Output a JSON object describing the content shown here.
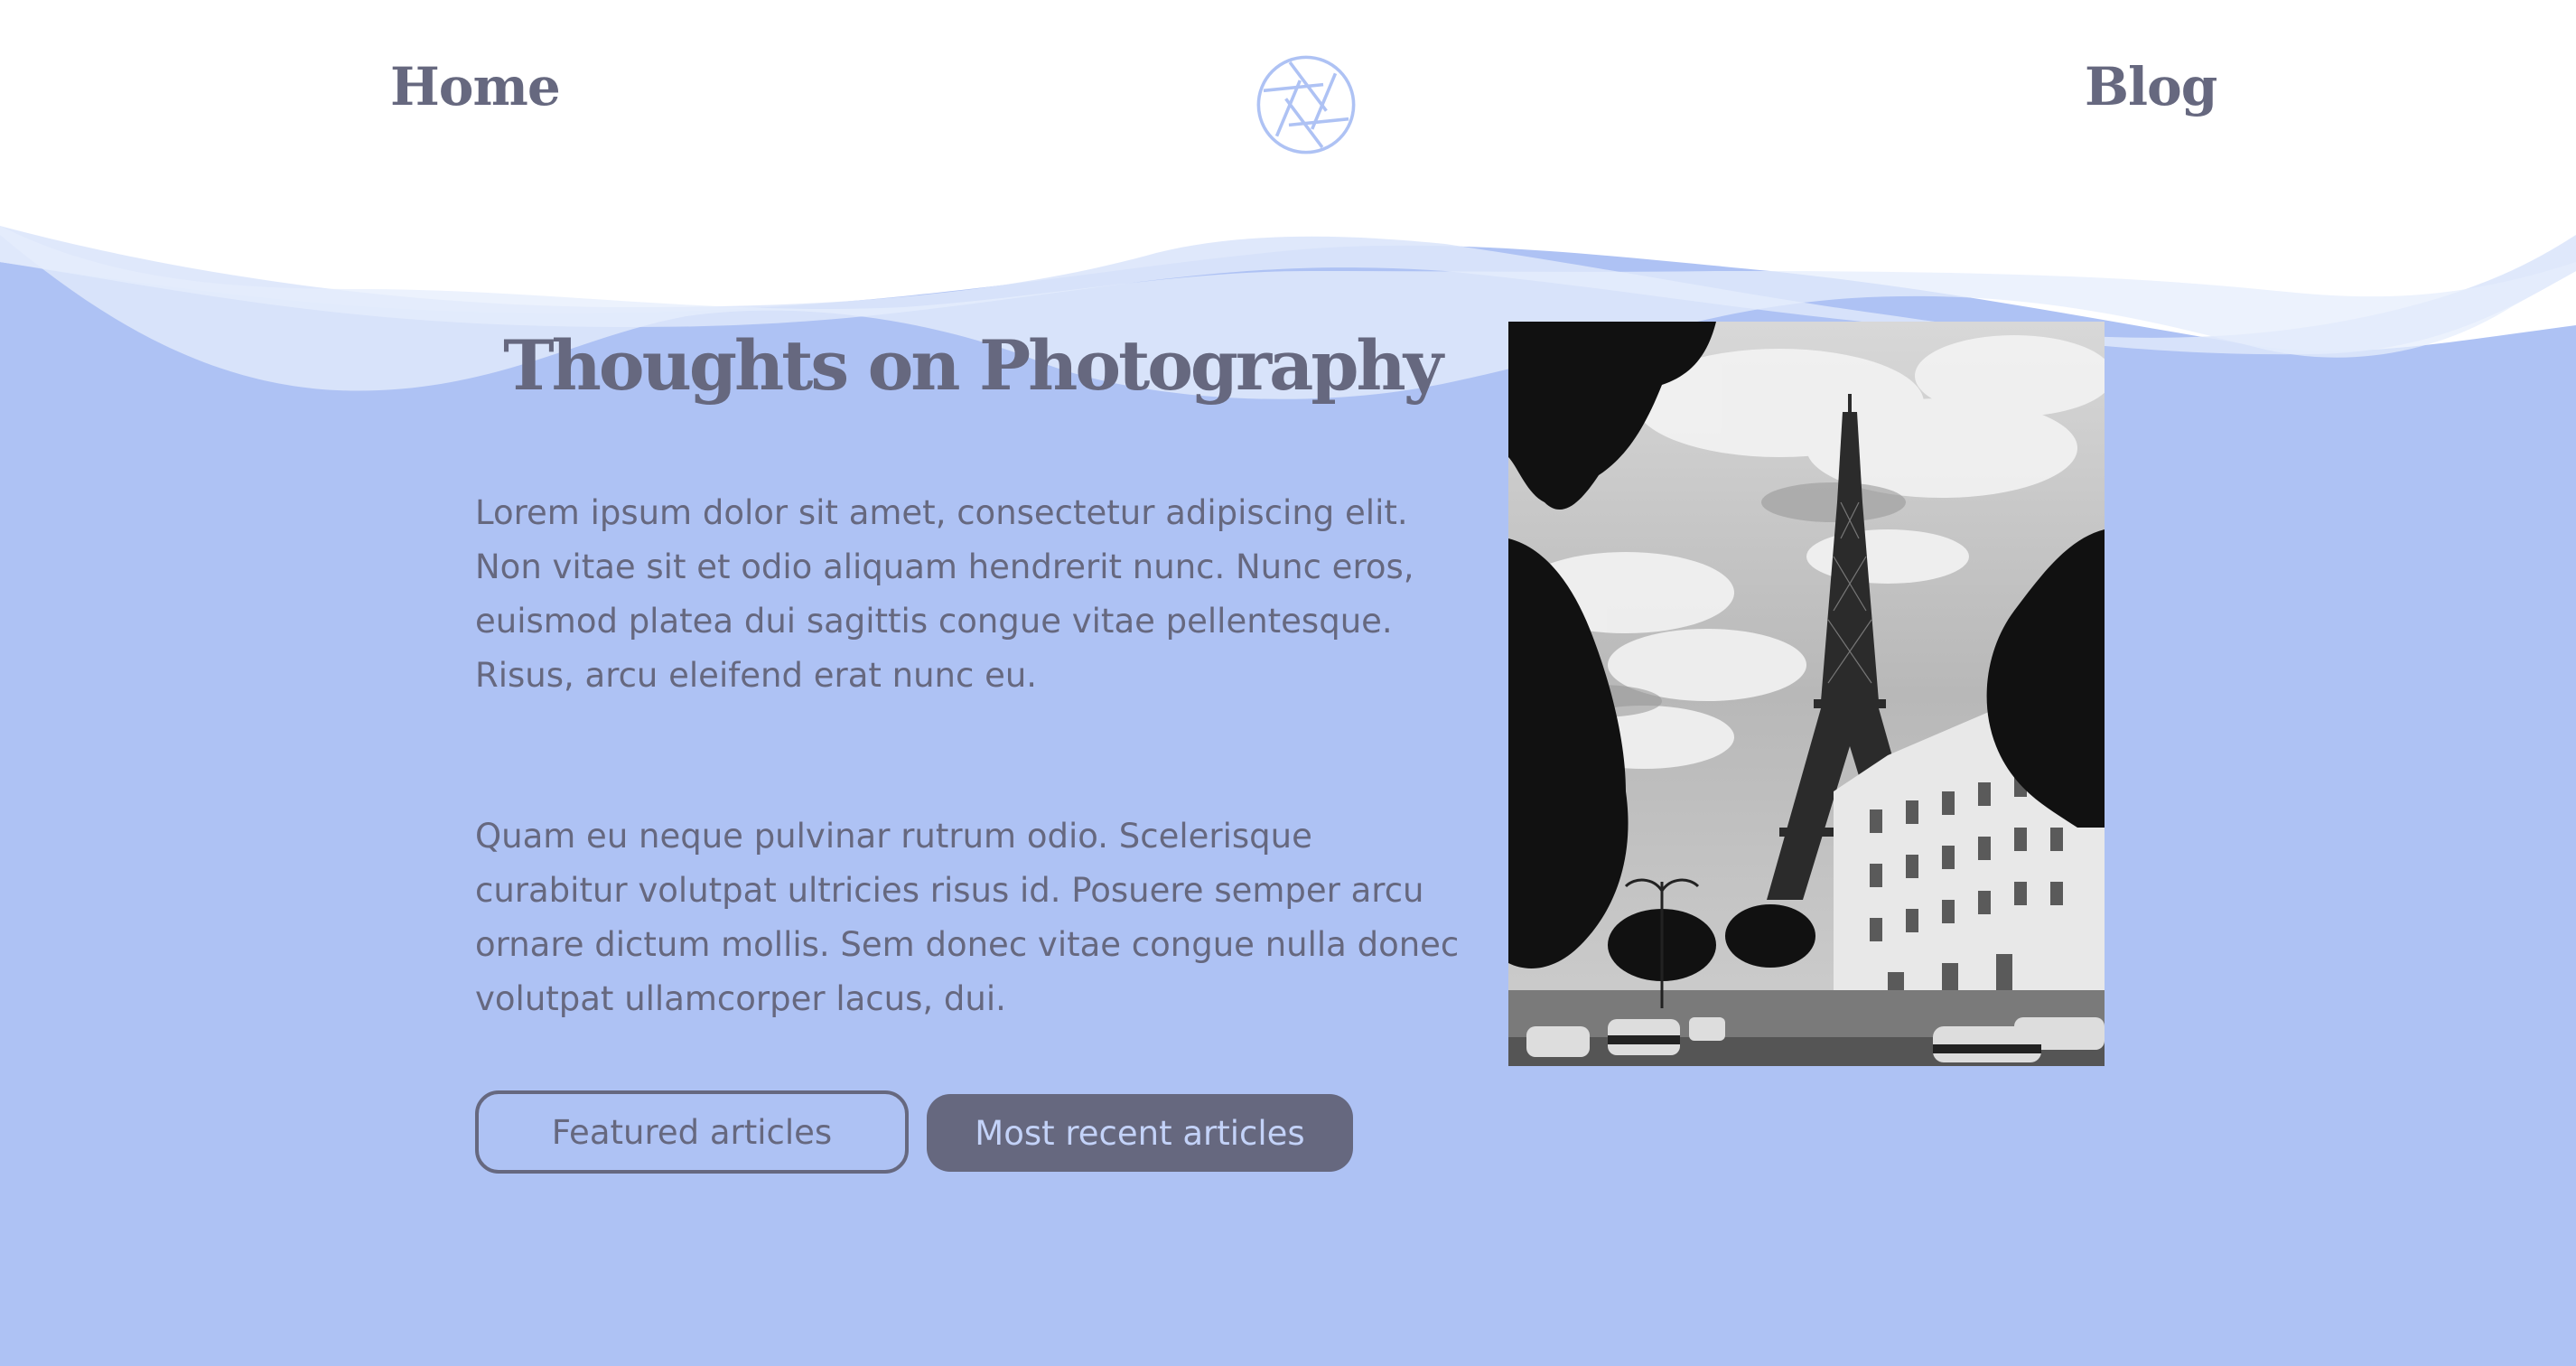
{
  "nav": {
    "home_label": "Home",
    "blog_label": "Blog",
    "logo_icon": "camera-aperture-icon"
  },
  "hero": {
    "title": "Thoughts on Photography",
    "paragraphs": [
      "Lorem ipsum dolor sit amet, consectetur adipiscing elit. Non vitae sit et odio aliquam hendrerit nunc. Nunc eros, euismod platea dui sagittis congue vitae pellentesque. Risus, arcu eleifend erat nunc eu.",
      "Quam eu neque pulvinar rutrum odio. Scelerisque curabitur volutpat ultricies risus id. Posuere semper arcu ornare dictum mollis. Sem donec vitae congue nulla donec volutpat ullamcorper lacus, dui."
    ],
    "buttons": {
      "featured_label": "Featured articles",
      "recent_label": "Most recent articles"
    },
    "image": {
      "subject": "black and white photo of the Eiffel Tower with trees, buildings and street traffic"
    }
  },
  "colors": {
    "background": "#aec2f4",
    "header": "#ffffff",
    "text": "#66687f",
    "accent_button": "#66687f",
    "accent_button_text": "#c3d2f8",
    "logo": "#aec2f4"
  }
}
